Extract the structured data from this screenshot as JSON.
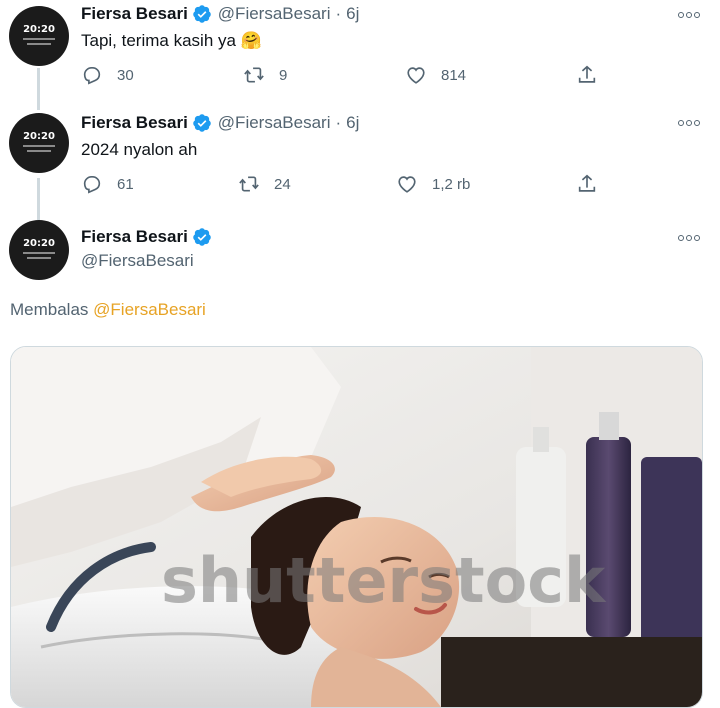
{
  "tweets": [
    {
      "name": "Fiersa Besari",
      "handle": "@FiersaBesari",
      "separator": "·",
      "time": "6j",
      "text": "Tapi, terima kasih ya 🤗",
      "replies": "30",
      "retweets": "9",
      "likes": "814"
    },
    {
      "name": "Fiersa Besari",
      "handle": "@FiersaBesari",
      "separator": "·",
      "time": "6j",
      "text": "2024 nyalon ah",
      "replies": "61",
      "retweets": "24",
      "likes": "1,2 rb"
    }
  ],
  "main_tweet": {
    "name": "Fiersa Besari",
    "handle": "@FiersaBesari",
    "reply_prefix": "Membalas",
    "reply_mention": "@FiersaBesari",
    "image_watermark": "shutterstock"
  },
  "avatar": {
    "label": "20:20"
  },
  "colors": {
    "text": "#0f1419",
    "muted": "#536471",
    "verified": "#1d9bf0",
    "mention": "#e7a325",
    "thread_line": "#cfd9de"
  },
  "icons": [
    "reply-icon",
    "retweet-icon",
    "like-icon",
    "share-icon",
    "more-icon",
    "verified-badge-icon"
  ]
}
